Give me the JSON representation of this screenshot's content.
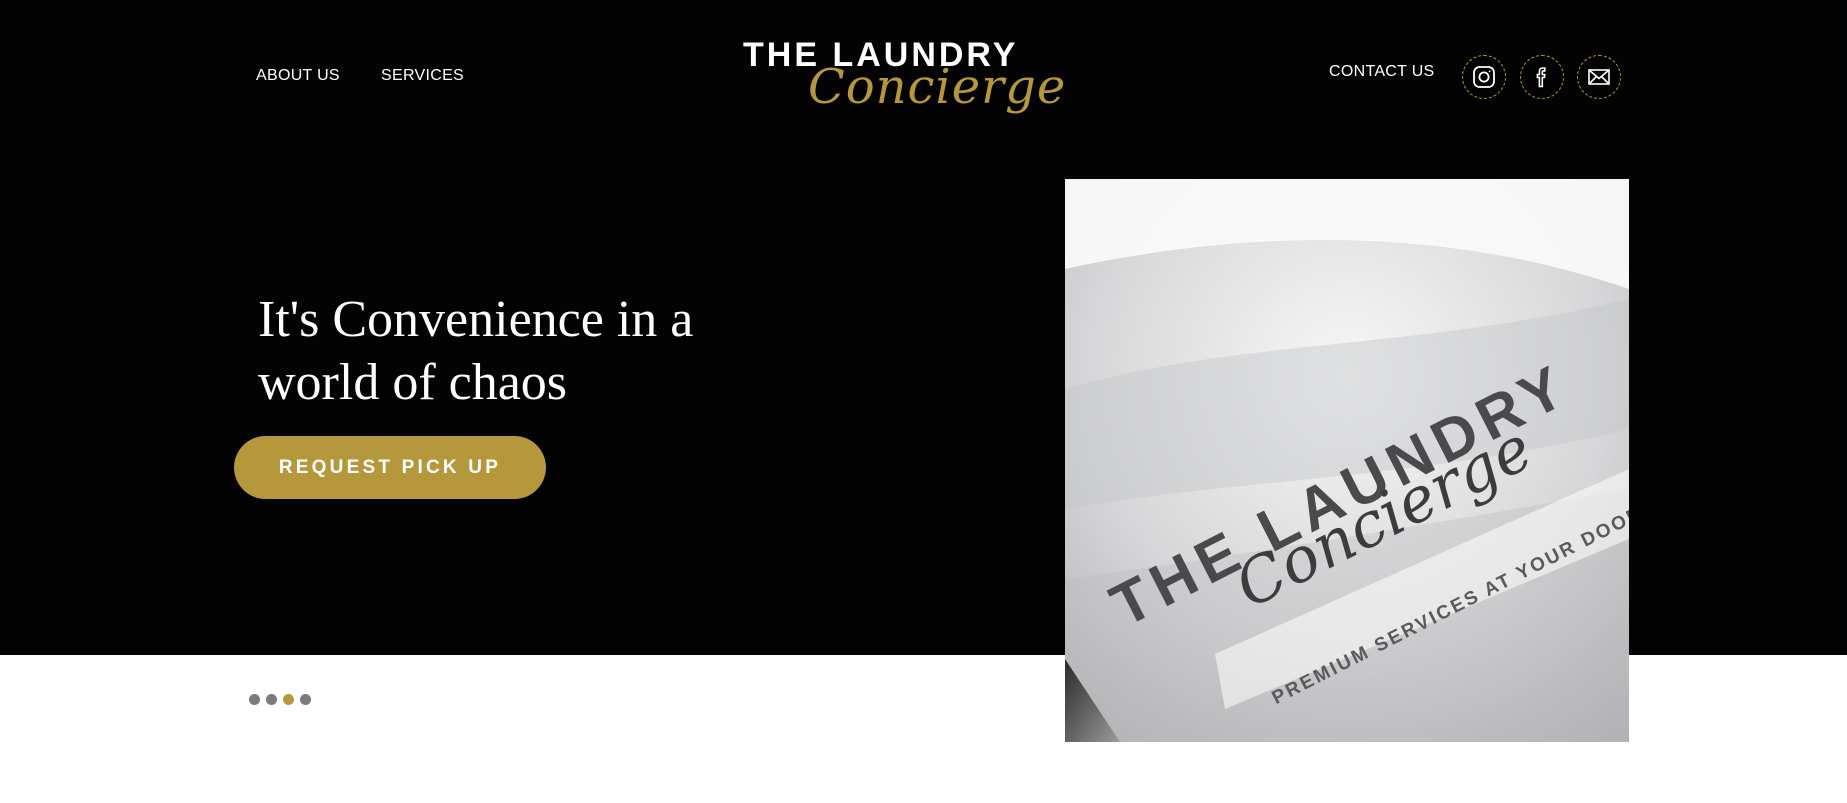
{
  "nav": {
    "about": "ABOUT US",
    "services": "SERVICES",
    "contact": "CONTACT US"
  },
  "logo": {
    "line1": "THE LAUNDRY",
    "line2": "Concierge"
  },
  "social": [
    {
      "icon": "instagram-icon"
    },
    {
      "icon": "facebook-icon"
    },
    {
      "icon": "mail-icon"
    }
  ],
  "hero": {
    "headline": "It's Convenience in a world of chaos",
    "cta": "REQUEST PICK UP"
  },
  "slider": {
    "total": 4,
    "active_index": 2
  },
  "image": {
    "brand_line1": "THE LAUNDRY",
    "brand_line2": "Concierge",
    "tagline": "PREMIUM SERVICES AT YOUR DOORSTEP"
  },
  "colors": {
    "background": "#030303",
    "accent": "#b6983c",
    "text": "#ffffff",
    "dot_inactive": "#7a7a7a"
  }
}
